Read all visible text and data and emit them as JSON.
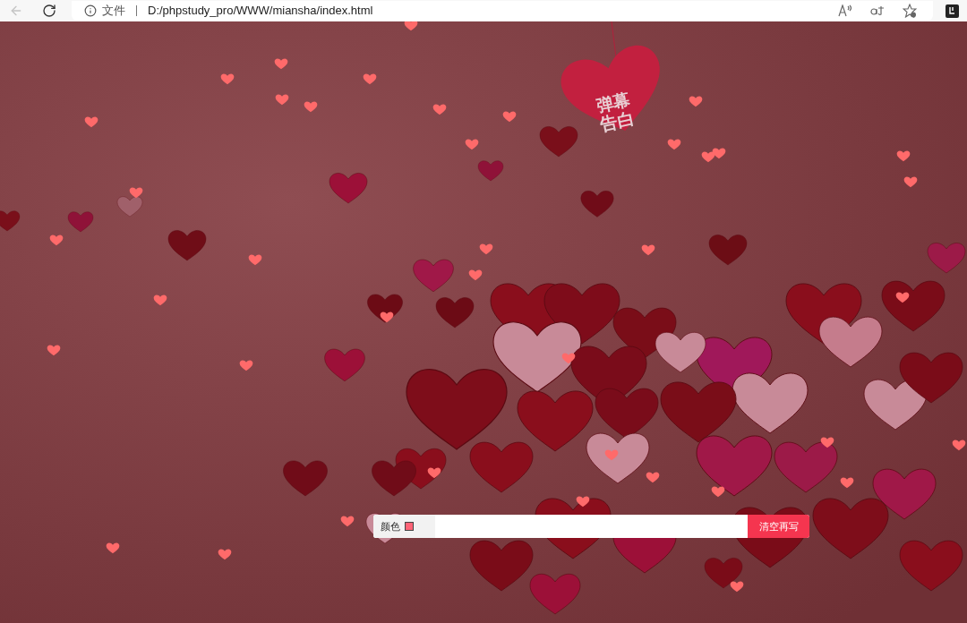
{
  "browser": {
    "back_disabled": true,
    "site_label": "文件",
    "url": "D:/phpstudy_pro/WWW/miansha/index.html"
  },
  "sign": {
    "lines": [
      "弹幕",
      "告白"
    ]
  },
  "barrage_bar": {
    "color_label": "颜色",
    "color": "#ff6477",
    "button": "清空再写"
  }
}
